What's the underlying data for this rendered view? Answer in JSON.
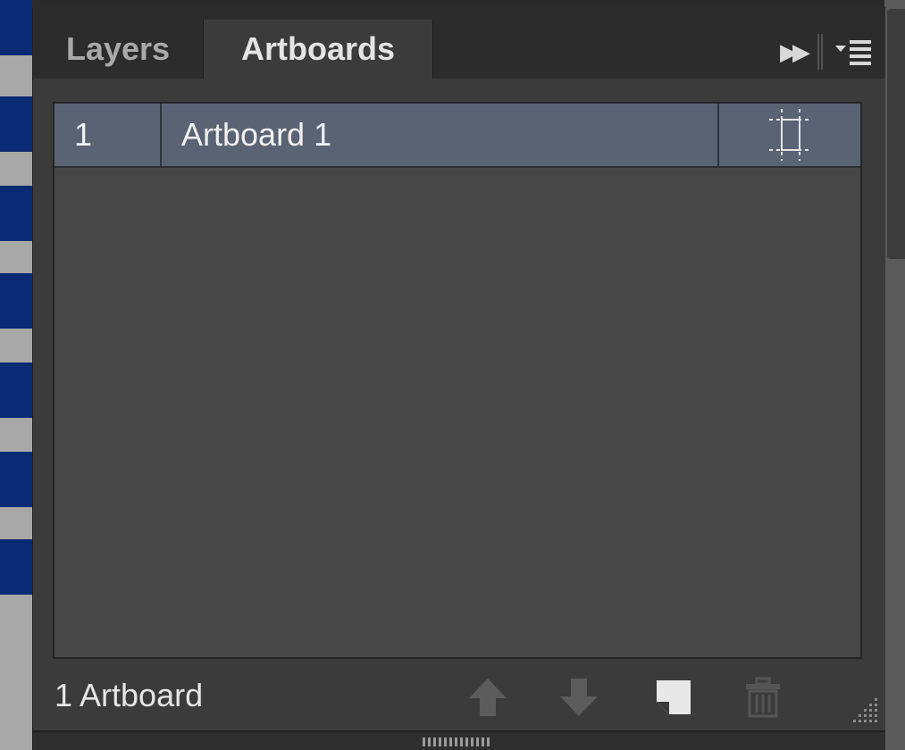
{
  "panel": {
    "tabs": [
      {
        "label": "Layers",
        "active": false
      },
      {
        "label": "Artboards",
        "active": true
      }
    ]
  },
  "artboards": [
    {
      "number": "1",
      "name": "Artboard 1",
      "selected": true
    }
  ],
  "footer": {
    "count_label": "1 Artboard",
    "buttons": [
      "move-up",
      "move-down",
      "new-artboard",
      "delete-artboard"
    ]
  },
  "colors": {
    "selected_row": "#5a6374",
    "panel_bg": "#3b3b3b",
    "list_bg": "#474747"
  }
}
